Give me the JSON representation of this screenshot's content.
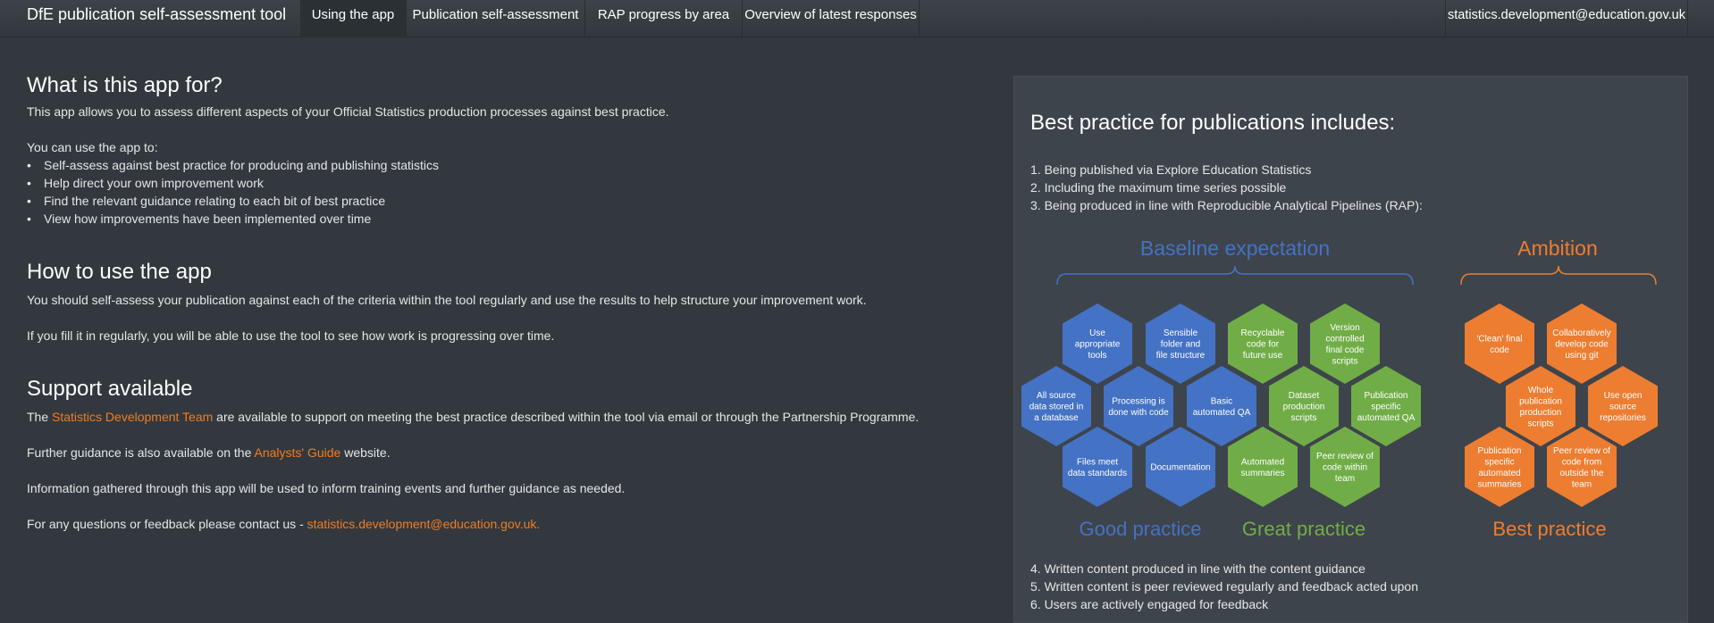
{
  "navbar": {
    "brand": "DfE publication self-assessment tool",
    "tabs": [
      {
        "label": "Using the app",
        "active": true
      },
      {
        "label": "Publication self-assessment",
        "active": false
      },
      {
        "label": "RAP progress by area",
        "active": false
      },
      {
        "label": "Overview of latest responses",
        "active": false
      }
    ],
    "email": "statistics.development@education.gov.uk"
  },
  "main": {
    "what_heading": "What is this app for?",
    "what_intro": "This app allows you to assess different aspects of your Official Statistics production processes against best practice.",
    "use_intro": "You can use the app to:",
    "uses": [
      "Self-assess against best practice for producing and publishing statistics",
      "Help direct your own improvement work",
      "Find the relevant guidance relating to each bit of best practice",
      "View how improvements have been implemented over time"
    ],
    "how_heading": "How to use the app",
    "how_p1": "You should self-assess your publication against each of the criteria within the tool regularly and use the results to help structure your improvement work.",
    "how_p2": "If you fill it in regularly, you will be able to use the tool to see how work is progressing over time.",
    "support_heading": "Support available",
    "support_p1_pre": "The ",
    "support_p1_link": "Statistics Development Team",
    "support_p1_post": " are available to support on meeting the best practice described within the tool via email or through the Partnership Programme.",
    "support_p2_pre": "Further guidance is also available on the ",
    "support_p2_link": "Analysts' Guide",
    "support_p2_post": " website.",
    "support_p3": "Information gathered through this app will be used to inform training events and further guidance as needed.",
    "support_p4_pre": "For any questions or feedback please contact us - ",
    "support_p4_link": "statistics.development@education.gov.uk."
  },
  "panel": {
    "heading": "Best practice for publications includes:",
    "list_top": [
      "1. Being published via Explore Education Statistics",
      "2. Including the maximum time series possible",
      "3. Being produced in line with Reproducible Analytical Pipelines (RAP):"
    ],
    "list_bottom": [
      "4. Written content produced in line with the content guidance",
      "5. Written content is peer reviewed regularly and feedback acted upon",
      "6. Users are actively engaged for feedback"
    ]
  },
  "diagram": {
    "colors": {
      "blue": "#4472c4",
      "green": "#70ad47",
      "orange": "#ed7d31"
    },
    "baseline_label": "Baseline expectation",
    "ambition_label": "Ambition",
    "good_label": "Good practice",
    "great_label": "Great practice",
    "best_label": "Best practice",
    "hexes": [
      {
        "text": "Use appropriate tools",
        "color": "blue"
      },
      {
        "text": "Sensible folder and file structure",
        "color": "blue"
      },
      {
        "text": "Recyclable code for future use",
        "color": "green"
      },
      {
        "text": "Version controlled final code scripts",
        "color": "green"
      },
      {
        "text": "All source data stored in a database",
        "color": "blue"
      },
      {
        "text": "Processing is done with code",
        "color": "blue"
      },
      {
        "text": "Basic automated QA",
        "color": "blue"
      },
      {
        "text": "Dataset production scripts",
        "color": "green"
      },
      {
        "text": "Publication specific automated QA",
        "color": "green"
      },
      {
        "text": "Files meet data standards",
        "color": "blue"
      },
      {
        "text": "Documentation",
        "color": "blue"
      },
      {
        "text": "Automated summaries",
        "color": "green"
      },
      {
        "text": "Peer review of code within team",
        "color": "green"
      },
      {
        "text": "'Clean' final code",
        "color": "orange"
      },
      {
        "text": "Collaboratively develop code using git",
        "color": "orange"
      },
      {
        "text": "Whole publication production scripts",
        "color": "orange"
      },
      {
        "text": "Use open source repositories",
        "color": "orange"
      },
      {
        "text": "Publication specific automated summaries",
        "color": "orange"
      },
      {
        "text": "Peer review of code from outside the team",
        "color": "orange"
      }
    ]
  }
}
